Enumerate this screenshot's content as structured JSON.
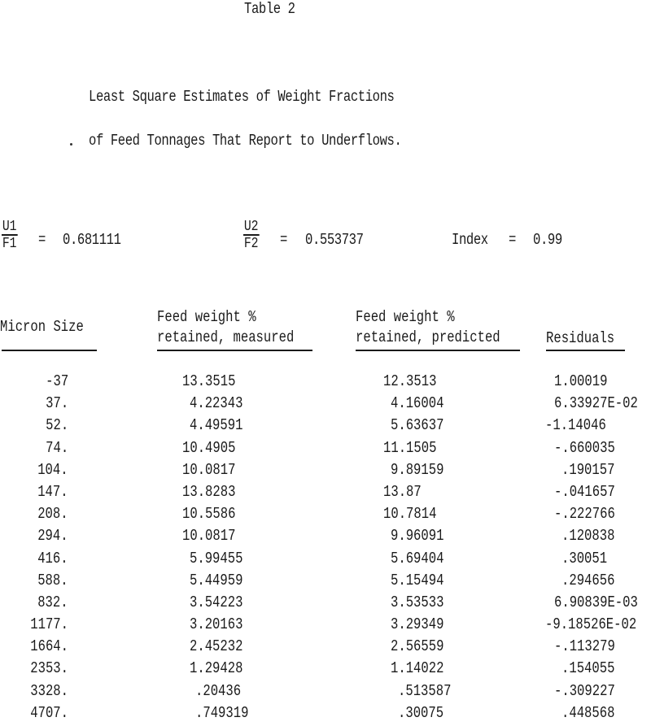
{
  "document": {
    "table_title": "Table 2",
    "subtitle_line1": "Least Square Estimates of Weight Fractions",
    "subtitle_line2": "of Feed Tonnages That Report to Underflows."
  },
  "ratios": {
    "ratio1": {
      "numerator": "U1",
      "denominator": "F1",
      "equals": "=",
      "value": "0.681111"
    },
    "ratio2": {
      "numerator": "U2",
      "denominator": "F2",
      "equals": "=",
      "value": "0.553737"
    },
    "index": {
      "label": "Index",
      "equals": "=",
      "value": "0.99"
    }
  },
  "table": {
    "headers": {
      "micron_size": "Micron Size",
      "measured_line1": "Feed weight %",
      "measured_line2": "retained, measured",
      "predicted_line1": "Feed weight %",
      "predicted_line2": "retained, predicted",
      "residuals": "Residuals"
    },
    "rows": [
      {
        "size": "-37",
        "measured": "13.3515",
        "predicted": "12.3513",
        "residual": "1.00019"
      },
      {
        "size": "37.",
        "measured": "4.22343",
        "predicted": "4.16004",
        "residual": "6.33927E-02"
      },
      {
        "size": "52.",
        "measured": "4.49591",
        "predicted": "5.63637",
        "residual": "-1.14046"
      },
      {
        "size": "74.",
        "measured": "10.4905",
        "predicted": "11.1505",
        "residual": "-.660035"
      },
      {
        "size": "104.",
        "measured": "10.0817",
        "predicted": "9.89159",
        "residual": ".190157"
      },
      {
        "size": "147.",
        "measured": "13.8283",
        "predicted": "13.87",
        "residual": "-.041657"
      },
      {
        "size": "208.",
        "measured": "10.5586",
        "predicted": "10.7814",
        "residual": "-.222766"
      },
      {
        "size": "294.",
        "measured": "10.0817",
        "predicted": "9.96091",
        "residual": ".120838"
      },
      {
        "size": "416.",
        "measured": "5.99455",
        "predicted": "5.69404",
        "residual": ".30051"
      },
      {
        "size": "588.",
        "measured": "5.44959",
        "predicted": "5.15494",
        "residual": ".294656"
      },
      {
        "size": "832.",
        "measured": "3.54223",
        "predicted": "3.53533",
        "residual": "6.90839E-03"
      },
      {
        "size": "1177.",
        "measured": "3.20163",
        "predicted": "3.29349",
        "residual": "-9.18526E-02"
      },
      {
        "size": "1664.",
        "measured": "2.45232",
        "predicted": "2.56559",
        "residual": "-.113279"
      },
      {
        "size": "2353.",
        "measured": "1.29428",
        "predicted": "1.14022",
        "residual": ".154055"
      },
      {
        "size": "3328.",
        "measured": ".20436",
        "predicted": ".513587",
        "residual": "-.309227"
      },
      {
        "size": "4707.",
        "measured": ".749319",
        "predicted": ".30075",
        "residual": ".448568"
      }
    ]
  }
}
